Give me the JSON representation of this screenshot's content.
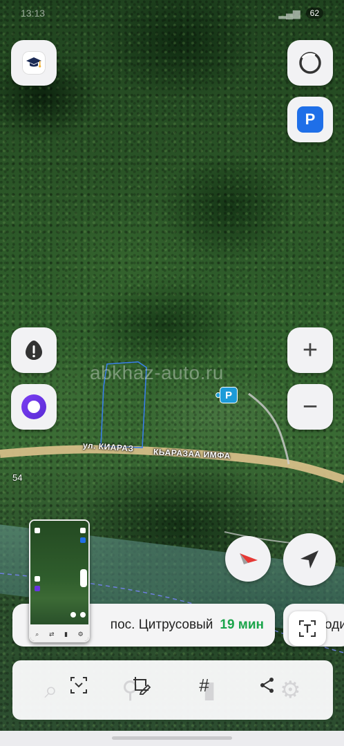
{
  "status_bar": {
    "time": "13:13",
    "battery": "62"
  },
  "map": {
    "watermark": "abkhaz-auto.ru",
    "road_label_1": "ул. КИАРАЗ",
    "road_label_2": "КЬАРАЗАА ИМФА",
    "road_number": "54",
    "parking_marker": "P"
  },
  "controls": {
    "parking_button": "P",
    "zoom_in": "+",
    "zoom_out": "−"
  },
  "route_card": {
    "destination": "пос. Цитрусовый",
    "eta": "19 мин",
    "next_card_text": "оди"
  },
  "toolbar": {
    "hash_label": "#"
  },
  "colors": {
    "accent_blue": "#1f6fe8",
    "eta_green": "#1aa44a",
    "alice_purple": "#6a34e4",
    "compass_red": "#e53935"
  }
}
